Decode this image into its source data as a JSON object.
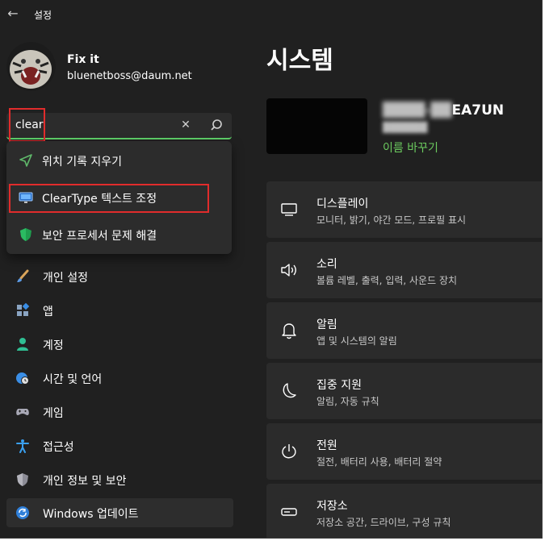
{
  "app": {
    "title": "설정"
  },
  "user": {
    "name": "Fix it",
    "email": "bluenetboss@daum.net"
  },
  "search": {
    "value": "clear"
  },
  "search_results": [
    {
      "label": "위치 기록 지우기",
      "icon": "location-arrow-icon"
    },
    {
      "label": "ClearType 텍스트 조정",
      "icon": "monitor-icon"
    },
    {
      "label": "보안 프로세서 문제 해결",
      "icon": "shield-icon"
    }
  ],
  "nav": [
    {
      "label": "개인 설정",
      "icon": "paintbrush-icon"
    },
    {
      "label": "앱",
      "icon": "apps-icon"
    },
    {
      "label": "계정",
      "icon": "person-icon"
    },
    {
      "label": "시간 및 언어",
      "icon": "globe-clock-icon"
    },
    {
      "label": "게임",
      "icon": "gamepad-icon"
    },
    {
      "label": "접근성",
      "icon": "accessibility-icon"
    },
    {
      "label": "개인 정보 및 보안",
      "icon": "shield-icon"
    },
    {
      "label": "Windows 업데이트",
      "icon": "sync-icon"
    }
  ],
  "main": {
    "title": "시스템",
    "device": {
      "name_visible": "EA7UN",
      "rename_label": "이름 바꾸기"
    },
    "cards": [
      {
        "title": "디스플레이",
        "desc": "모니터, 밝기, 야간 모드, 프로필 표시",
        "icon": "display-icon"
      },
      {
        "title": "소리",
        "desc": "볼륨 레벨, 출력, 입력, 사운드 장치",
        "icon": "speaker-icon"
      },
      {
        "title": "알림",
        "desc": "앱 및 시스템의 알림",
        "icon": "bell-icon"
      },
      {
        "title": "집중 지원",
        "desc": "알림, 자동 규칙",
        "icon": "moon-icon"
      },
      {
        "title": "전원",
        "desc": "절전, 배터리 사용, 배터리 절약",
        "icon": "power-icon"
      },
      {
        "title": "저장소",
        "desc": "저장소 공간, 드라이브, 구성 규칙",
        "icon": "storage-icon"
      }
    ]
  },
  "colors": {
    "accent": "#6ccb5f",
    "highlight": "#e12c2c",
    "background": "#202020",
    "card": "#2b2b2b"
  }
}
